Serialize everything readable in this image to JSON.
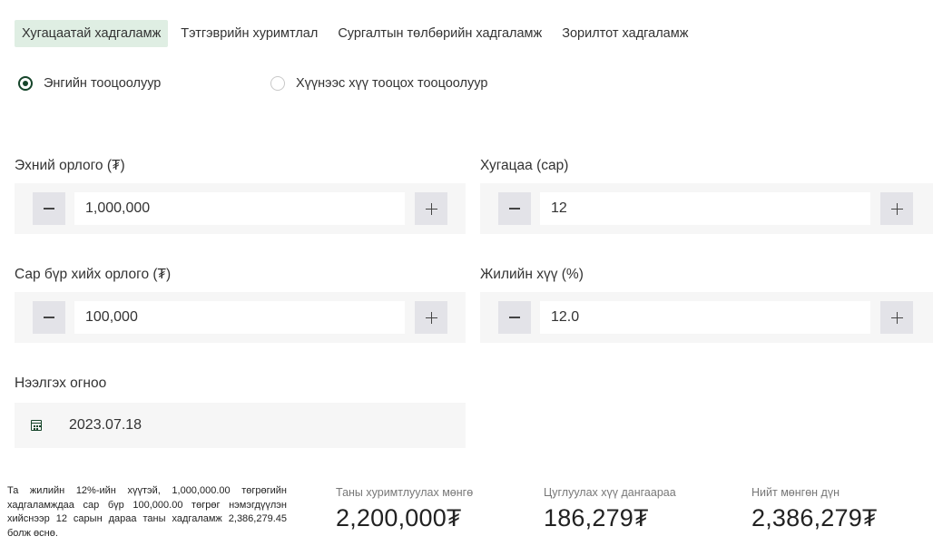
{
  "tabs": [
    {
      "label": "Хугацаатай хадгаламж",
      "active": true
    },
    {
      "label": "Тэтгэврийн хуримтлал",
      "active": false
    },
    {
      "label": "Сургалтын төлбөрийн хадгаламж",
      "active": false
    },
    {
      "label": "Зорилтот хадгаламж",
      "active": false
    }
  ],
  "calculator_mode": {
    "simple": {
      "label": "Энгийн тооцоолуур",
      "selected": true
    },
    "compound": {
      "label": "Хүүнээс хүү тооцох тооцоолуур",
      "selected": false
    }
  },
  "fields": {
    "initial_income": {
      "label": "Эхний орлого (₮)",
      "value": "1,000,000"
    },
    "duration": {
      "label": "Хугацаа (сар)",
      "value": "12"
    },
    "monthly_income": {
      "label": "Сар бүр хийх орлого (₮)",
      "value": "100,000"
    },
    "annual_rate": {
      "label": "Жилийн хүү (%)",
      "value": "12.0"
    },
    "open_date": {
      "label": "Нээлгэх огноо",
      "value": "2023.07.18"
    }
  },
  "icons": {
    "decrement": "minus-icon",
    "increment": "plus-icon",
    "date": "calendar-icon"
  },
  "summary_text": "Та жилийн 12%-ийн хүүтэй, 1,000,000.00 төгрөгийн хадгаламждаа сар бүр 100,000.00 төгрөг нэмэгдүүлэн хийснээр 12 сарын дараа таны хадгаламж 2,386,279.45 болж өснө.",
  "results": {
    "savings": {
      "label": "Таны хуримтлуулах мөнгө",
      "value": "2,200,000₮"
    },
    "interest": {
      "label": "Цуглуулах хүү дангаараа",
      "value": "186,279₮"
    },
    "total": {
      "label": "Нийт мөнгөн дүн",
      "value": "2,386,279₮"
    }
  },
  "colors": {
    "accent": "#16452a",
    "active_tab_bg": "#dfeee3",
    "field_bg": "#f6f6f6",
    "button_bg": "#e3e3e8"
  }
}
